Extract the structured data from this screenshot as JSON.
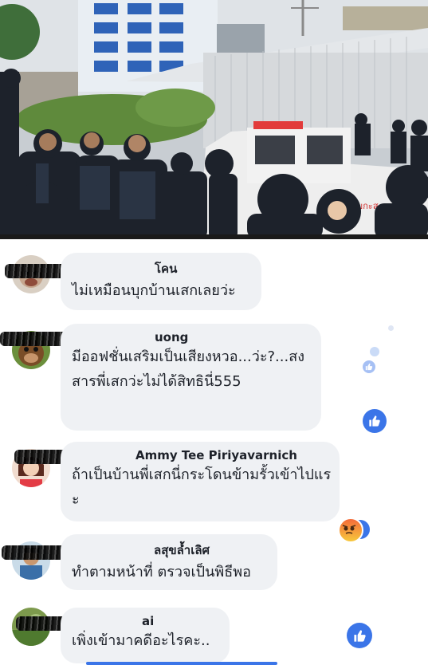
{
  "photo": {
    "vehicle_text": "มกะส"
  },
  "comments": [
    {
      "name": "โคน",
      "text": "ไม่เหมือนบุกบ้านเสกเลยว่ะ"
    },
    {
      "name": "uong",
      "text": "มีออฟชั่นเสริมเป็นเสียงหวอ...ว่ะ?...สงสารพี่เสกว่ะไม่ได้สิทธินี่555"
    },
    {
      "name": "Ammy Tee Piriyavarnich",
      "text": "ถ้าเป็นบ้านพี่เสกนี่กระโดนข้ามรั้วเข้าไปแระ"
    },
    {
      "name": "ลสุขล้ำเลิศ",
      "text": "ทำตามหน้าที่ ตรวจเป็นพิธีพอ"
    },
    {
      "name": "ai",
      "text": "เพิ่งเข้ามาคดีอะไรคะ.."
    }
  ],
  "reactions": [
    "like-icon",
    "angry-icon",
    "like-icon"
  ]
}
